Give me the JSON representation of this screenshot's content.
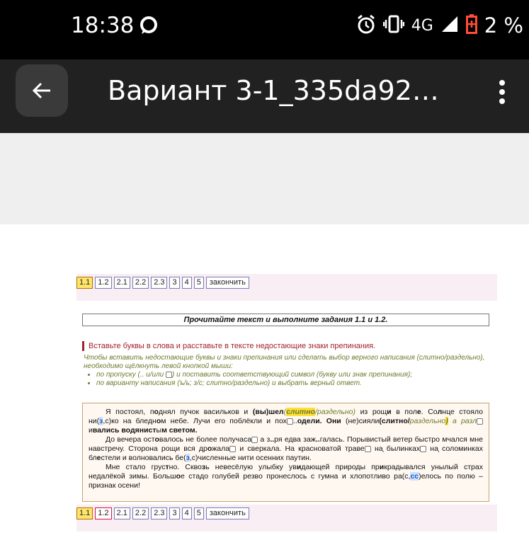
{
  "status_bar": {
    "time": "18:38",
    "network": "4G",
    "battery_percent": "2 %",
    "icons": [
      "chat-bubble-icon",
      "alarm-icon",
      "vibrate-icon",
      "signal-icon",
      "battery-low-icon"
    ]
  },
  "app_bar": {
    "title": "Вариант 3-1_335da92…"
  },
  "nav": {
    "top": [
      "1.1",
      "1.2",
      "2.1",
      "2.2",
      "2.3",
      "3",
      "4",
      "5",
      "закончить"
    ],
    "bottom": [
      "1.1",
      "1.2",
      "2.1",
      "2.2",
      "2.3",
      "3",
      "4",
      "5",
      "закончить"
    ]
  },
  "heading": "Прочитайте текст и выполните задания 1.1 и 1.2.",
  "task_title": "Вставьте буквы в слова и расставьте в тексте недостающие знаки препинания.",
  "instructions": {
    "intro": "Чтобы вставить недостающие буквы и знаки препинания или сделать выбор верного написания (слитно/раздельно), необходимо щёлкнуть левой кнопкой мыши:",
    "item1_a": "по пропуску (.. и/или ",
    "item1_b": ") и поставить соответствующий символ (букву или знак препинания);",
    "item2": "по варианту написания (ъ/ь; з/с; слитно/раздельно) и выбрать верный ответ."
  },
  "text": {
    "p1": [
      "Я постоял, п",
      "о",
      "днял пучок васильков и ",
      "(вы)шел",
      "(",
      "слитно",
      "/раздельно)",
      " из рощ",
      "и",
      " в пол",
      "е",
      ". Со",
      "л",
      "нце стояло ни(",
      "з",
      ",с)ко на бледн",
      "о",
      "м небе. Лучи его поблёкли",
      " и пох",
      "..",
      "одели. Они ",
      "(не)сияли",
      "(слитно/",
      "раздельно",
      ")",
      " а разл",
      "и",
      "вались водянист",
      "ы",
      "м светом."
    ],
    "p2": [
      "До вечера ост",
      "о",
      "валось не более получаса",
      " а з",
      "..",
      "ря едва заж",
      "..",
      "галась. Порывистый ветер быстро мчался мне навстречу. Сторона рощи вся др",
      "о",
      "жала",
      " и сверкала. На красноватой траве",
      ",",
      " на былинках",
      ",",
      " на соломинках бл",
      "е",
      "стели и волновались бе(",
      "з",
      ",с)численные нити осенних паутин."
    ],
    "p3": [
      "Мне стало грус",
      "т",
      "но. Скво",
      "з",
      "ь невесёлую улыбку ув",
      "и",
      "дающей природы пр",
      "и",
      "крадывался унылый страх недалёкой зимы. Больш",
      "о",
      "е стадо голубей резво пронеслось с гумна и хлопотливо ра(с,",
      "сс",
      ")елось по полю – признак осени!"
    ]
  }
}
